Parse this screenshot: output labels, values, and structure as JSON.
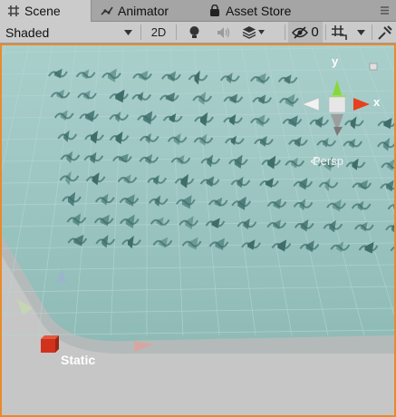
{
  "tabs": [
    {
      "label": "Scene",
      "icon": "grid-icon",
      "active": true
    },
    {
      "label": "Animator",
      "icon": "animator-icon",
      "active": false
    },
    {
      "label": "Asset Store",
      "icon": "store-bag-icon",
      "active": false
    }
  ],
  "toolbar": {
    "shading_mode": "Shaded",
    "mode_2d": "2D",
    "hidden_count": "0"
  },
  "gizmo": {
    "y_label": "y",
    "x_label": "x",
    "projection": "Persp"
  },
  "scene": {
    "static_label": "Static"
  },
  "colors": {
    "selection_border": "#e98a2c",
    "ground": "#9fc7c3",
    "gizmo_y": "#86d83a",
    "gizmo_x": "#e8401e",
    "static_cube": "#d0321d"
  }
}
